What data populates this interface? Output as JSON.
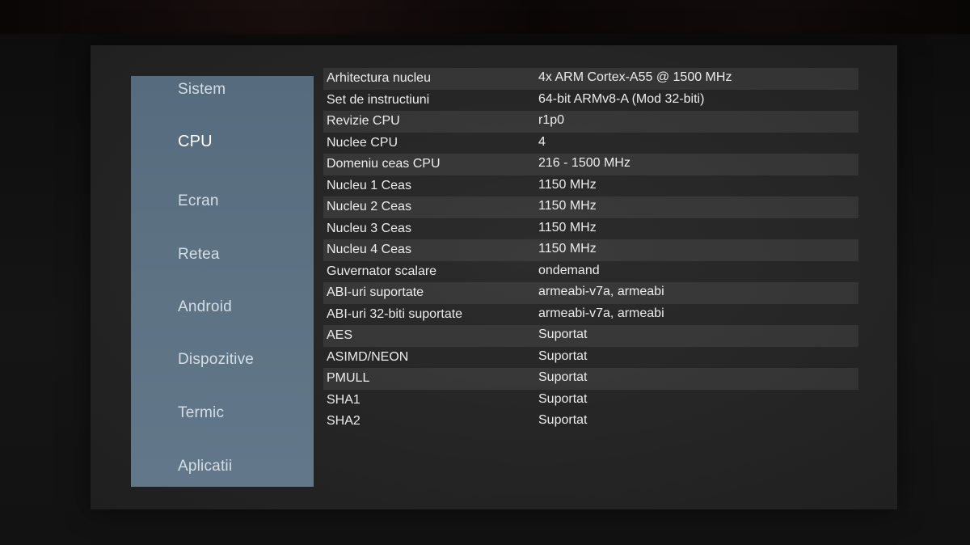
{
  "sidebar": {
    "items": [
      {
        "label": "Sistem",
        "active": false
      },
      {
        "label": "CPU",
        "active": true
      },
      {
        "label": "Ecran",
        "active": false
      },
      {
        "label": "Retea",
        "active": false
      },
      {
        "label": "Android",
        "active": false
      },
      {
        "label": "Dispozitive",
        "active": false
      },
      {
        "label": "Termic",
        "active": false
      },
      {
        "label": "Aplicatii",
        "active": false
      }
    ]
  },
  "cpu_info": {
    "rows": [
      {
        "label": "Arhitectura nucleu",
        "value": "4x ARM Cortex-A55 @ 1500 MHz"
      },
      {
        "label": "Set de instructiuni",
        "value": "64-bit ARMv8-A (Mod 32-biti)"
      },
      {
        "label": "Revizie CPU",
        "value": "r1p0"
      },
      {
        "label": "Nuclee CPU",
        "value": "4"
      },
      {
        "label": "Domeniu ceas CPU",
        "value": "216 - 1500 MHz"
      },
      {
        "label": "Nucleu 1 Ceas",
        "value": "1150 MHz"
      },
      {
        "label": "Nucleu 2 Ceas",
        "value": "1150 MHz"
      },
      {
        "label": "Nucleu 3 Ceas",
        "value": "1150 MHz"
      },
      {
        "label": "Nucleu 4 Ceas",
        "value": "1150 MHz"
      },
      {
        "label": "Guvernator scalare",
        "value": "ondemand"
      },
      {
        "label": "ABI-uri suportate",
        "value": "armeabi-v7a, armeabi"
      },
      {
        "label": "ABI-uri 32-biti suportate",
        "value": "armeabi-v7a, armeabi"
      },
      {
        "label": "AES",
        "value": "Suportat"
      },
      {
        "label": "ASIMD/NEON",
        "value": "Suportat"
      },
      {
        "label": "PMULL",
        "value": "Suportat"
      },
      {
        "label": "SHA1",
        "value": "Suportat"
      },
      {
        "label": "SHA2",
        "value": "Suportat"
      }
    ]
  },
  "colors": {
    "sidebar_bg": "#5d7384",
    "screen_bg": "#282828",
    "text": "#ececec",
    "stripe": "#333333"
  }
}
